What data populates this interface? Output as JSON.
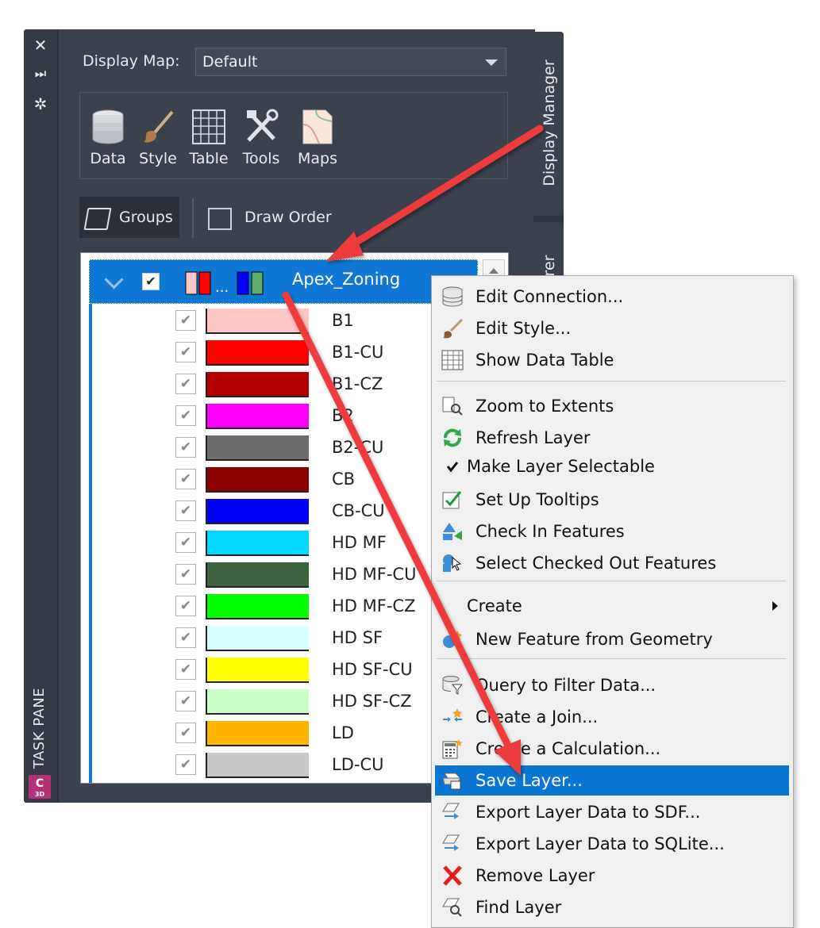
{
  "task_pane": {
    "label": "TASK PANE",
    "logo_letter": "C",
    "logo_sub": "3D"
  },
  "display_map": {
    "label": "Display Map:",
    "value": "Default"
  },
  "toolbar": [
    {
      "label": "Data",
      "icon": "database-icon"
    },
    {
      "label": "Style",
      "icon": "brush-icon"
    },
    {
      "label": "Table",
      "icon": "table-icon"
    },
    {
      "label": "Tools",
      "icon": "tools-icon"
    },
    {
      "label": "Maps",
      "icon": "map-icon"
    }
  ],
  "view_tabs": {
    "groups": "Groups",
    "draw_order": "Draw Order"
  },
  "side_tabs": {
    "display_manager": "Display Manager",
    "other": "rer"
  },
  "group": {
    "name": "Apex_Zoning",
    "swatch_ellipsis": "..."
  },
  "layers": [
    {
      "name": "B1",
      "color": "#ffc6c6"
    },
    {
      "name": "B1-CU",
      "color": "#ff0000"
    },
    {
      "name": "B1-CZ",
      "color": "#b40000"
    },
    {
      "name": "B2",
      "color": "#ff00ff"
    },
    {
      "name": "B2-CU",
      "color": "#6b6b6b"
    },
    {
      "name": "CB",
      "color": "#8c0000"
    },
    {
      "name": "CB-CU",
      "color": "#0000ff"
    },
    {
      "name": "HD MF",
      "color": "#00d8ff"
    },
    {
      "name": "HD MF-CU",
      "color": "#3d6341"
    },
    {
      "name": "HD MF-CZ",
      "color": "#00ff00"
    },
    {
      "name": "HD SF",
      "color": "#d6ffff"
    },
    {
      "name": "HD SF-CU",
      "color": "#ffff00"
    },
    {
      "name": "HD SF-CZ",
      "color": "#c8ffc8"
    },
    {
      "name": "LD",
      "color": "#ffb400"
    },
    {
      "name": "LD-CU",
      "color": "#c8c8c8"
    }
  ],
  "menu": {
    "items": [
      {
        "label": "Edit Connection...",
        "icon": "database-icon"
      },
      {
        "label": "Edit Style...",
        "icon": "brush-icon"
      },
      {
        "label": "Show Data Table",
        "icon": "table-icon"
      },
      {
        "label": "Zoom to Extents",
        "icon": "zoom-extents-icon"
      },
      {
        "label": "Refresh Layer",
        "icon": "refresh-icon"
      },
      {
        "label": "Make Layer Selectable",
        "icon": "checkmark-icon"
      },
      {
        "label": "Set Up Tooltips",
        "icon": "tooltip-checkbox-icon"
      },
      {
        "label": "Check In Features",
        "icon": "check-in-icon"
      },
      {
        "label": "Select Checked Out Features",
        "icon": "select-checked-out-icon"
      },
      {
        "label": "Create",
        "icon": ""
      },
      {
        "label": "New Feature from Geometry",
        "icon": "new-feature-icon"
      },
      {
        "label": "Query to Filter Data...",
        "icon": "query-filter-icon"
      },
      {
        "label": "Create a Join...",
        "icon": "join-icon"
      },
      {
        "label": "Create a Calculation...",
        "icon": "calculator-icon"
      },
      {
        "label": "Save Layer...",
        "icon": "save-layer-icon"
      },
      {
        "label": "Export Layer Data to SDF...",
        "icon": "export-sdf-icon"
      },
      {
        "label": "Export Layer Data to SQLite...",
        "icon": "export-sqlite-icon"
      },
      {
        "label": "Remove Layer",
        "icon": "remove-icon"
      },
      {
        "label": "Find Layer",
        "icon": "find-layer-icon"
      }
    ],
    "selected": "Save Layer..."
  },
  "colors": {
    "panel_bg": "#3b414d",
    "selection_blue": "#0f78d4",
    "annotation_arrow": "#ee3b3b"
  }
}
